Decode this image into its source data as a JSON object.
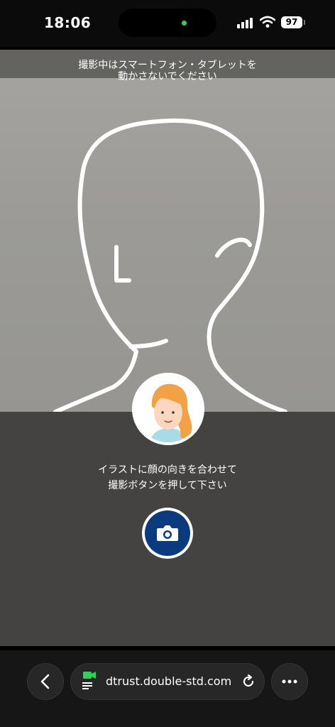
{
  "status_bar": {
    "time": "18:06",
    "battery": "97",
    "icons": [
      "signal-icon",
      "wifi-icon",
      "battery-icon"
    ]
  },
  "camera": {
    "top_instruction_line1": "撮影中はスマートフォン・タブレットを",
    "top_instruction_line2": "動かさないでください",
    "bottom_instruction_line1": "イラストに顔の向きを合わせて",
    "bottom_instruction_line2": "撮影ボタンを押して下さい",
    "shutter_icon": "camera-icon",
    "accent_color": "#0a3b7f"
  },
  "browser": {
    "url": "dtrust.double-std.com",
    "icons": [
      "back-icon",
      "video-icon",
      "reload-icon",
      "more-icon"
    ]
  }
}
